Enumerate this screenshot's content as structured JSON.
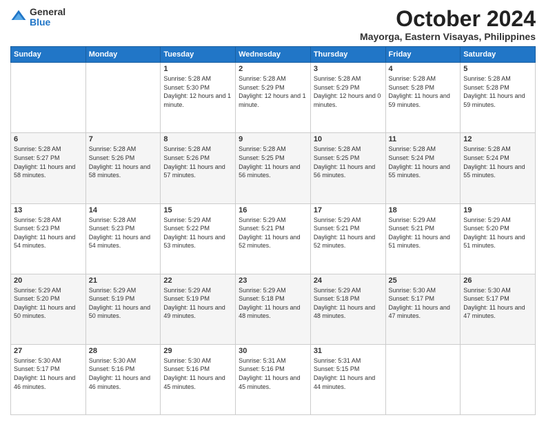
{
  "logo": {
    "general": "General",
    "blue": "Blue"
  },
  "header": {
    "month": "October 2024",
    "location": "Mayorga, Eastern Visayas, Philippines"
  },
  "weekdays": [
    "Sunday",
    "Monday",
    "Tuesday",
    "Wednesday",
    "Thursday",
    "Friday",
    "Saturday"
  ],
  "weeks": [
    [
      {
        "day": "",
        "sunrise": "",
        "sunset": "",
        "daylight": ""
      },
      {
        "day": "",
        "sunrise": "",
        "sunset": "",
        "daylight": ""
      },
      {
        "day": "1",
        "sunrise": "Sunrise: 5:28 AM",
        "sunset": "Sunset: 5:30 PM",
        "daylight": "Daylight: 12 hours and 1 minute."
      },
      {
        "day": "2",
        "sunrise": "Sunrise: 5:28 AM",
        "sunset": "Sunset: 5:29 PM",
        "daylight": "Daylight: 12 hours and 1 minute."
      },
      {
        "day": "3",
        "sunrise": "Sunrise: 5:28 AM",
        "sunset": "Sunset: 5:29 PM",
        "daylight": "Daylight: 12 hours and 0 minutes."
      },
      {
        "day": "4",
        "sunrise": "Sunrise: 5:28 AM",
        "sunset": "Sunset: 5:28 PM",
        "daylight": "Daylight: 11 hours and 59 minutes."
      },
      {
        "day": "5",
        "sunrise": "Sunrise: 5:28 AM",
        "sunset": "Sunset: 5:28 PM",
        "daylight": "Daylight: 11 hours and 59 minutes."
      }
    ],
    [
      {
        "day": "6",
        "sunrise": "Sunrise: 5:28 AM",
        "sunset": "Sunset: 5:27 PM",
        "daylight": "Daylight: 11 hours and 58 minutes."
      },
      {
        "day": "7",
        "sunrise": "Sunrise: 5:28 AM",
        "sunset": "Sunset: 5:26 PM",
        "daylight": "Daylight: 11 hours and 58 minutes."
      },
      {
        "day": "8",
        "sunrise": "Sunrise: 5:28 AM",
        "sunset": "Sunset: 5:26 PM",
        "daylight": "Daylight: 11 hours and 57 minutes."
      },
      {
        "day": "9",
        "sunrise": "Sunrise: 5:28 AM",
        "sunset": "Sunset: 5:25 PM",
        "daylight": "Daylight: 11 hours and 56 minutes."
      },
      {
        "day": "10",
        "sunrise": "Sunrise: 5:28 AM",
        "sunset": "Sunset: 5:25 PM",
        "daylight": "Daylight: 11 hours and 56 minutes."
      },
      {
        "day": "11",
        "sunrise": "Sunrise: 5:28 AM",
        "sunset": "Sunset: 5:24 PM",
        "daylight": "Daylight: 11 hours and 55 minutes."
      },
      {
        "day": "12",
        "sunrise": "Sunrise: 5:28 AM",
        "sunset": "Sunset: 5:24 PM",
        "daylight": "Daylight: 11 hours and 55 minutes."
      }
    ],
    [
      {
        "day": "13",
        "sunrise": "Sunrise: 5:28 AM",
        "sunset": "Sunset: 5:23 PM",
        "daylight": "Daylight: 11 hours and 54 minutes."
      },
      {
        "day": "14",
        "sunrise": "Sunrise: 5:28 AM",
        "sunset": "Sunset: 5:23 PM",
        "daylight": "Daylight: 11 hours and 54 minutes."
      },
      {
        "day": "15",
        "sunrise": "Sunrise: 5:29 AM",
        "sunset": "Sunset: 5:22 PM",
        "daylight": "Daylight: 11 hours and 53 minutes."
      },
      {
        "day": "16",
        "sunrise": "Sunrise: 5:29 AM",
        "sunset": "Sunset: 5:21 PM",
        "daylight": "Daylight: 11 hours and 52 minutes."
      },
      {
        "day": "17",
        "sunrise": "Sunrise: 5:29 AM",
        "sunset": "Sunset: 5:21 PM",
        "daylight": "Daylight: 11 hours and 52 minutes."
      },
      {
        "day": "18",
        "sunrise": "Sunrise: 5:29 AM",
        "sunset": "Sunset: 5:21 PM",
        "daylight": "Daylight: 11 hours and 51 minutes."
      },
      {
        "day": "19",
        "sunrise": "Sunrise: 5:29 AM",
        "sunset": "Sunset: 5:20 PM",
        "daylight": "Daylight: 11 hours and 51 minutes."
      }
    ],
    [
      {
        "day": "20",
        "sunrise": "Sunrise: 5:29 AM",
        "sunset": "Sunset: 5:20 PM",
        "daylight": "Daylight: 11 hours and 50 minutes."
      },
      {
        "day": "21",
        "sunrise": "Sunrise: 5:29 AM",
        "sunset": "Sunset: 5:19 PM",
        "daylight": "Daylight: 11 hours and 50 minutes."
      },
      {
        "day": "22",
        "sunrise": "Sunrise: 5:29 AM",
        "sunset": "Sunset: 5:19 PM",
        "daylight": "Daylight: 11 hours and 49 minutes."
      },
      {
        "day": "23",
        "sunrise": "Sunrise: 5:29 AM",
        "sunset": "Sunset: 5:18 PM",
        "daylight": "Daylight: 11 hours and 48 minutes."
      },
      {
        "day": "24",
        "sunrise": "Sunrise: 5:29 AM",
        "sunset": "Sunset: 5:18 PM",
        "daylight": "Daylight: 11 hours and 48 minutes."
      },
      {
        "day": "25",
        "sunrise": "Sunrise: 5:30 AM",
        "sunset": "Sunset: 5:17 PM",
        "daylight": "Daylight: 11 hours and 47 minutes."
      },
      {
        "day": "26",
        "sunrise": "Sunrise: 5:30 AM",
        "sunset": "Sunset: 5:17 PM",
        "daylight": "Daylight: 11 hours and 47 minutes."
      }
    ],
    [
      {
        "day": "27",
        "sunrise": "Sunrise: 5:30 AM",
        "sunset": "Sunset: 5:17 PM",
        "daylight": "Daylight: 11 hours and 46 minutes."
      },
      {
        "day": "28",
        "sunrise": "Sunrise: 5:30 AM",
        "sunset": "Sunset: 5:16 PM",
        "daylight": "Daylight: 11 hours and 46 minutes."
      },
      {
        "day": "29",
        "sunrise": "Sunrise: 5:30 AM",
        "sunset": "Sunset: 5:16 PM",
        "daylight": "Daylight: 11 hours and 45 minutes."
      },
      {
        "day": "30",
        "sunrise": "Sunrise: 5:31 AM",
        "sunset": "Sunset: 5:16 PM",
        "daylight": "Daylight: 11 hours and 45 minutes."
      },
      {
        "day": "31",
        "sunrise": "Sunrise: 5:31 AM",
        "sunset": "Sunset: 5:15 PM",
        "daylight": "Daylight: 11 hours and 44 minutes."
      },
      {
        "day": "",
        "sunrise": "",
        "sunset": "",
        "daylight": ""
      },
      {
        "day": "",
        "sunrise": "",
        "sunset": "",
        "daylight": ""
      }
    ]
  ]
}
